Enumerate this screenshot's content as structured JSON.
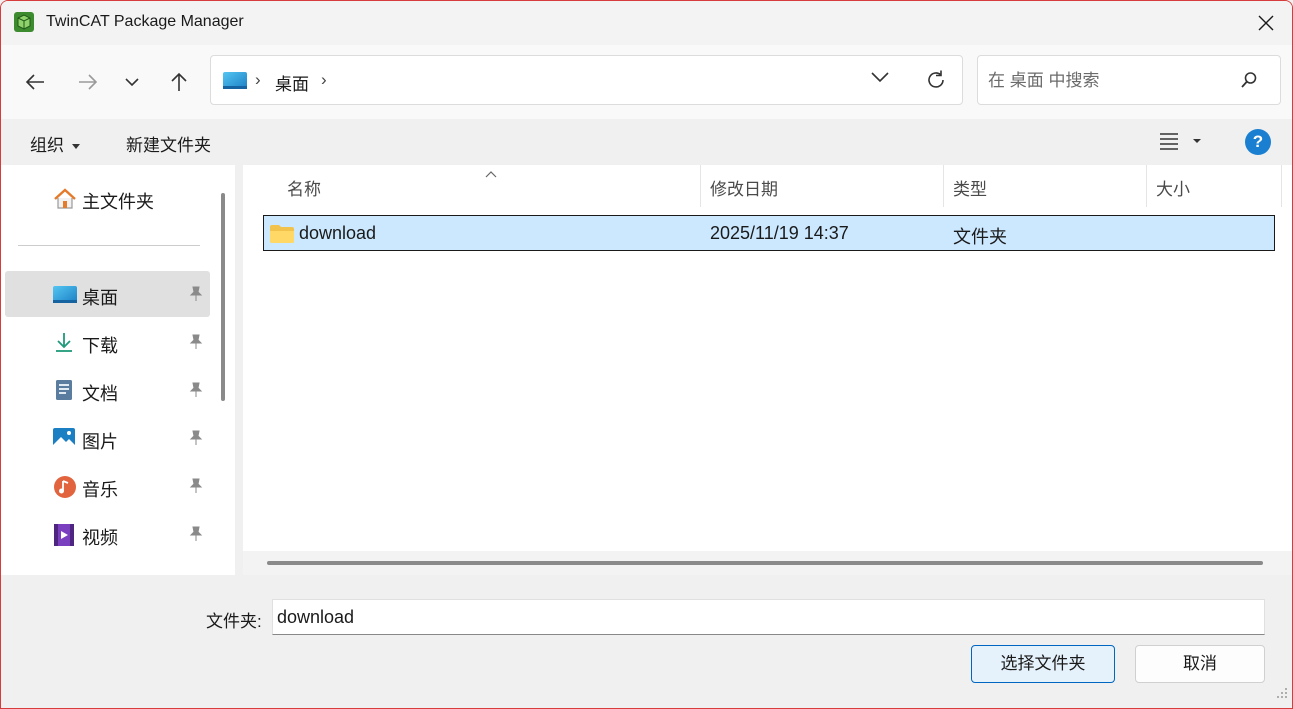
{
  "window": {
    "title": "TwinCAT Package Manager"
  },
  "navigation": {
    "breadcrumb": [
      "桌面"
    ],
    "search_placeholder": "在 桌面 中搜索"
  },
  "commandbar": {
    "organize_label": "组织",
    "new_folder_label": "新建文件夹",
    "help_label": "?"
  },
  "sidebar": {
    "home_label": "主文件夹",
    "items": [
      {
        "label": "桌面",
        "icon": "desktop-icon",
        "selected": true
      },
      {
        "label": "下载",
        "icon": "download-icon"
      },
      {
        "label": "文档",
        "icon": "document-icon"
      },
      {
        "label": "图片",
        "icon": "pictures-icon"
      },
      {
        "label": "音乐",
        "icon": "music-icon"
      },
      {
        "label": "视频",
        "icon": "video-icon"
      }
    ]
  },
  "file_list": {
    "columns": [
      "名称",
      "修改日期",
      "类型",
      "大小"
    ],
    "rows": [
      {
        "name": "download",
        "modified": "2025/11/19 14:37",
        "type": "文件夹",
        "size": "",
        "selected": true
      }
    ]
  },
  "footer": {
    "folder_label": "文件夹:",
    "folder_value": "download",
    "select_button": "选择文件夹",
    "cancel_button": "取消"
  },
  "colors": {
    "selection_bg": "#cce8ff",
    "primary_border": "#0067c0",
    "accent": "#1a7fd1"
  }
}
